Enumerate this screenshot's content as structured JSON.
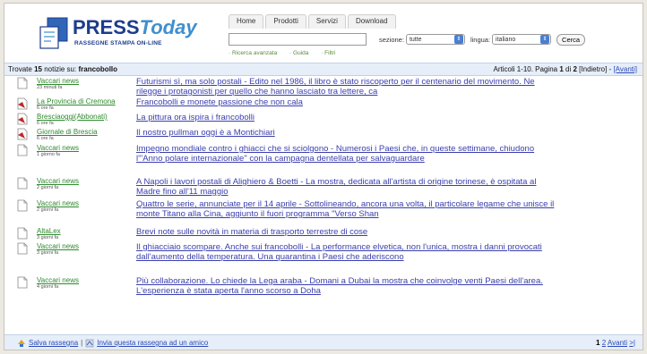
{
  "logo": {
    "press": "PRESS",
    "today": "Today",
    "subtitle": "RASSEGNE STAMPA ON-LINE"
  },
  "nav": {
    "tabs": [
      "Home",
      "Prodotti",
      "Servizi",
      "Download"
    ]
  },
  "search": {
    "value": "",
    "sezione_label": "sezione:",
    "sezione_value": "tutte",
    "lingua_label": "lingua:",
    "lingua_value": "italiano",
    "button": "Cerca",
    "links": [
      "Ricerca avanzata",
      "Guida",
      "Filtri"
    ]
  },
  "results": {
    "prefix": "Trovate",
    "count": "15",
    "middle": "notizie su:",
    "query": "francobollo",
    "articles": "Articoli 1-10. Pagina",
    "page": "1",
    "of": "di",
    "total_pages": "2",
    "back": "[Indietro]",
    "separator": "-",
    "next": "[Avanti]"
  },
  "items": [
    {
      "source": "Vaccari news",
      "time": "23 minuti fa",
      "icon": "page",
      "title": "Futurismi sì, ma solo postali - Edito nel 1986, il libro è stato riscoperto per il centenario del movimento. Ne rilegge i protagonisti per quello che hanno lasciato tra lettere, ca"
    },
    {
      "source": "La Provincia di Cremona",
      "time": "6 ore fa",
      "icon": "pdf",
      "title": "Francobolli e monete passione che non cala"
    },
    {
      "source": "Bresciaoggi(Abbonati)",
      "time": "6 ore fa",
      "icon": "pdf",
      "title": "La pittura ora ispira i francobolli"
    },
    {
      "source": "Giornale di Brescia",
      "time": "6 ore fa",
      "icon": "pdf",
      "title": "Il nostro pullman oggi è a Montichiari"
    },
    {
      "source": "Vaccari news",
      "time": "1 giorno fa",
      "icon": "page",
      "title": "Impegno mondiale contro i ghiacci che si sciolgono - Numerosi i Paesi che, in queste settimane, chiudono l'\"Anno polare internazionale\" con la campagna dentellata per salvaguardare"
    },
    {
      "source": "Vaccari news",
      "time": "2 giorni fa",
      "icon": "page",
      "title": "A Napoli i lavori postali di Alighiero & Boetti - La mostra, dedicata all'artista di origine torinese, è ospitata al Madre fino all'11 maggio"
    },
    {
      "source": "Vaccari news",
      "time": "2 giorni fa",
      "icon": "page",
      "title": "Quattro le serie, annunciate per il 14 aprile - Sottolineando, ancora una volta, il particolare legame che unisce il monte Titano alla Cina, aggiunto il fuori programma \"Verso Shan"
    },
    {
      "source": "AltaLex",
      "time": "3 giorni fa",
      "icon": "page",
      "title": "Brevi note sulle novità in materia di trasporto terrestre di cose"
    },
    {
      "source": "Vaccari news",
      "time": "3 giorni fa",
      "icon": "page",
      "title": "Il ghiacciaio scompare. Anche sui francobolli - La performance elvetica, non l'unica, mostra i danni provocati dall'aumento della temperatura. Una quarantina i Paesi che aderiscono"
    },
    {
      "source": "Vaccari news",
      "time": "4 giorni fa",
      "icon": "page",
      "title": "Più collaborazione. Lo chiede la Lega araba - Domani a Dubai la mostra che coinvolge venti Paesi dell'area. L'esperienza è stata aperta l'anno scorso a Doha"
    }
  ],
  "footer": {
    "save": "Salva rassegna",
    "divider": "|",
    "send": "Invia questa rassegna ad un amico",
    "page1": "1",
    "page2": "2",
    "next": "Avanti",
    "last": ">|"
  },
  "colors": {
    "link": "#3a3fae",
    "source": "#2f8a2f",
    "bar": "#e6eef9",
    "brand": "#1d3c8c",
    "brand_light": "#3f8fcf"
  }
}
